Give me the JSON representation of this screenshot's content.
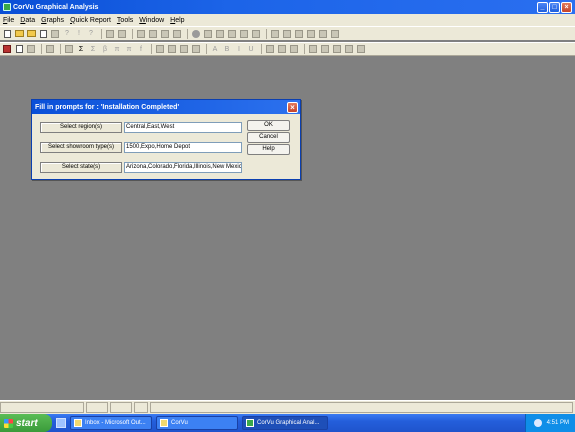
{
  "window": {
    "title": "CorVu Graphical Analysis"
  },
  "menubar": [
    {
      "u": "F",
      "rest": "ile"
    },
    {
      "u": "D",
      "rest": "ata"
    },
    {
      "u": "G",
      "rest": "raphs"
    },
    {
      "u": "Q",
      "rest": "uick Report"
    },
    {
      "u": "T",
      "rest": "ools"
    },
    {
      "u": "W",
      "rest": "indow"
    },
    {
      "u": "H",
      "rest": "elp"
    }
  ],
  "toolbar_glyphs": {
    "help": "?",
    "exclaim": "!",
    "sigma": "Σ",
    "beta": "β",
    "pi": "π",
    "func": "f",
    "bold": "B",
    "italic": "I",
    "underline": "U",
    "textA": "A"
  },
  "dialog": {
    "title": "Fill in prompts for : 'Installation Completed'",
    "prompts": [
      {
        "button": "Select region(s)",
        "value": "Central,East,West"
      },
      {
        "button": "Select showroom type(s)",
        "value": "1500,Expo,Home Depot"
      },
      {
        "button": "Select state(s)",
        "value": "Arizona,Colorado,Florida,Illinois,New Mexic"
      }
    ],
    "ok": "OK",
    "cancel": "Cancel",
    "help": "Help"
  },
  "taskbar": {
    "start": "start",
    "tasks": [
      "Inbox - Microsoft Out...",
      "CorVu",
      "CorVu Graphical Anal..."
    ],
    "clock": "4:51 PM"
  }
}
